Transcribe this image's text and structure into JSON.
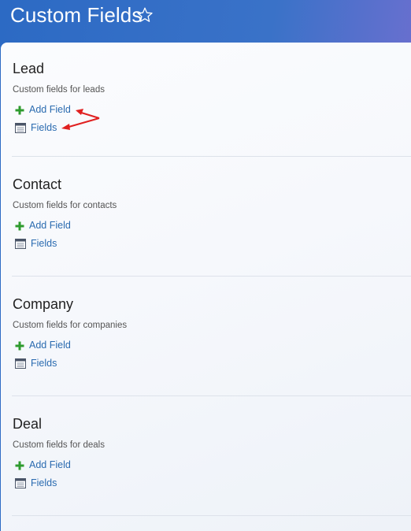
{
  "header": {
    "title": "Custom Fields",
    "favorite_icon": "star-outline-icon"
  },
  "sections": [
    {
      "title": "Lead",
      "description": "Custom fields for leads",
      "add_label": "Add Field",
      "fields_label": "Fields"
    },
    {
      "title": "Contact",
      "description": "Custom fields for contacts",
      "add_label": "Add Field",
      "fields_label": "Fields"
    },
    {
      "title": "Company",
      "description": "Custom fields for companies",
      "add_label": "Add Field",
      "fields_label": "Fields"
    },
    {
      "title": "Deal",
      "description": "Custom fields for deals",
      "add_label": "Add Field",
      "fields_label": "Fields"
    }
  ],
  "icons": {
    "add": "plus-icon",
    "fields": "list-icon"
  },
  "colors": {
    "link": "#2a6bb0",
    "plus": "#2e9b2e",
    "annotation_arrow": "#e02020"
  }
}
